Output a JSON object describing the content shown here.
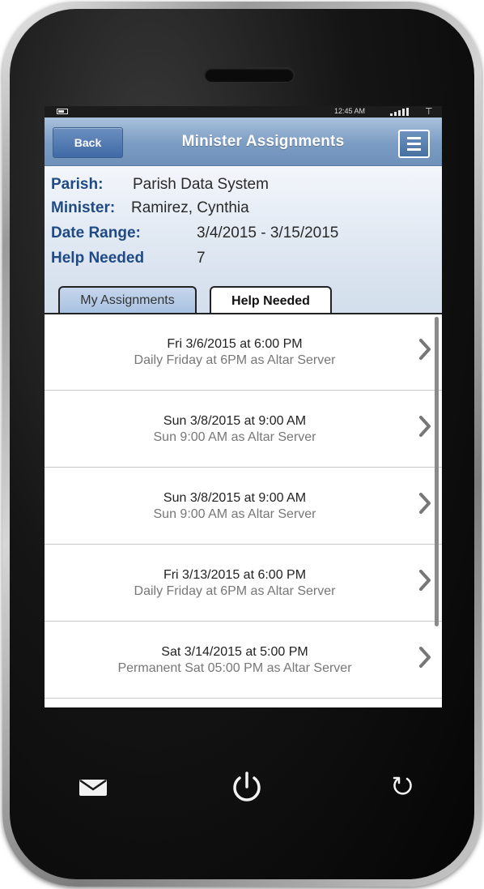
{
  "status_bar": {
    "time": "12:45 AM"
  },
  "header": {
    "back_label": "Back",
    "title": "Minister Assignments"
  },
  "info": {
    "parish_label": "Parish:",
    "parish_value": "Parish Data System",
    "minister_label": "Minister:",
    "minister_value": "Ramirez, Cynthia",
    "date_range_label": "Date Range:",
    "date_range_value": "3/4/2015 - 3/15/2015",
    "help_needed_label": "Help Needed",
    "help_needed_value": "7"
  },
  "tabs": [
    {
      "label": "My Assignments",
      "active": false
    },
    {
      "label": "Help Needed",
      "active": true
    }
  ],
  "assignments": [
    {
      "title": "Fri 3/6/2015 at 6:00 PM",
      "subtitle": "Daily Friday at 6PM as Altar Server"
    },
    {
      "title": "Sun 3/8/2015 at 9:00 AM",
      "subtitle": "Sun 9:00 AM as Altar Server"
    },
    {
      "title": "Sun 3/8/2015 at 9:00 AM",
      "subtitle": "Sun 9:00 AM as Altar Server"
    },
    {
      "title": "Fri 3/13/2015 at 6:00 PM",
      "subtitle": "Daily Friday at 6PM as Altar Server"
    },
    {
      "title": "Sat 3/14/2015 at 5:00 PM",
      "subtitle": "Permanent Sat 05:00 PM as Altar Server"
    }
  ],
  "icons": {
    "menu": "hamburger-menu-icon",
    "chevron": "chevron-right-icon",
    "hardware": [
      "mail-icon",
      "power-icon",
      "refresh-icon"
    ]
  },
  "colors": {
    "header_blue": "#7b9cc3",
    "label_blue": "#1f4a86",
    "button_blue": "#3f6aa6"
  }
}
